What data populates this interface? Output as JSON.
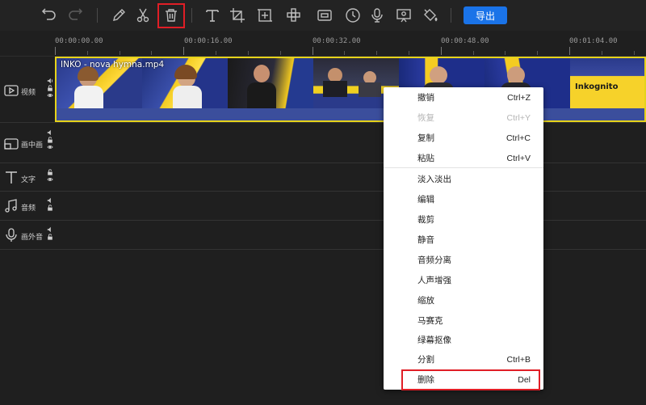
{
  "toolbar": {
    "export_label": "导出",
    "tools": [
      "undo-icon",
      "redo-icon",
      "pen-icon",
      "scissors-icon",
      "trash-icon",
      "text-icon",
      "crop-icon",
      "add-frame-icon",
      "mosaic-icon",
      "record-screen-icon",
      "clock-icon",
      "microphone-icon",
      "screen-share-icon",
      "paint-bucket-icon"
    ]
  },
  "ruler": {
    "ticks": [
      "00:00:00.00",
      "00:00:16.00",
      "00:00:32.00",
      "00:00:48.00",
      "00:01:04.00"
    ]
  },
  "tracks": [
    {
      "label": "视频",
      "icon": "video-track-icon"
    },
    {
      "label": "画中画",
      "icon": "pip-track-icon"
    },
    {
      "label": "文字",
      "icon": "text-track-icon"
    },
    {
      "label": "音频",
      "icon": "music-track-icon"
    },
    {
      "label": "画外音",
      "icon": "voiceover-track-icon"
    }
  ],
  "clip": {
    "title": "INKO - nova hymna.mp4",
    "thumb_logo": "Inkognito"
  },
  "context_menu": {
    "items": [
      {
        "label": "撤销",
        "shortcut": "Ctrl+Z",
        "disabled": false
      },
      {
        "label": "恢复",
        "shortcut": "Ctrl+Y",
        "disabled": true
      },
      {
        "label": "复制",
        "shortcut": "Ctrl+C",
        "disabled": false
      },
      {
        "label": "粘贴",
        "shortcut": "Ctrl+V",
        "disabled": false
      },
      {
        "label": "淡入淡出",
        "shortcut": "",
        "disabled": false
      },
      {
        "label": "编辑",
        "shortcut": "",
        "disabled": false
      },
      {
        "label": "裁剪",
        "shortcut": "",
        "disabled": false
      },
      {
        "label": "静音",
        "shortcut": "",
        "disabled": false
      },
      {
        "label": "音频分离",
        "shortcut": "",
        "disabled": false
      },
      {
        "label": "人声增强",
        "shortcut": "",
        "disabled": false
      },
      {
        "label": "缩放",
        "shortcut": "",
        "disabled": false
      },
      {
        "label": "马赛克",
        "shortcut": "",
        "disabled": false
      },
      {
        "label": "绿幕抠像",
        "shortcut": "",
        "disabled": false
      },
      {
        "label": "分割",
        "shortcut": "Ctrl+B",
        "disabled": false
      },
      {
        "label": "删除",
        "shortcut": "Del",
        "disabled": false
      }
    ]
  },
  "colors": {
    "highlight": "#e01e26",
    "accent": "#1a73e8",
    "clip_border": "#e6d31a"
  }
}
